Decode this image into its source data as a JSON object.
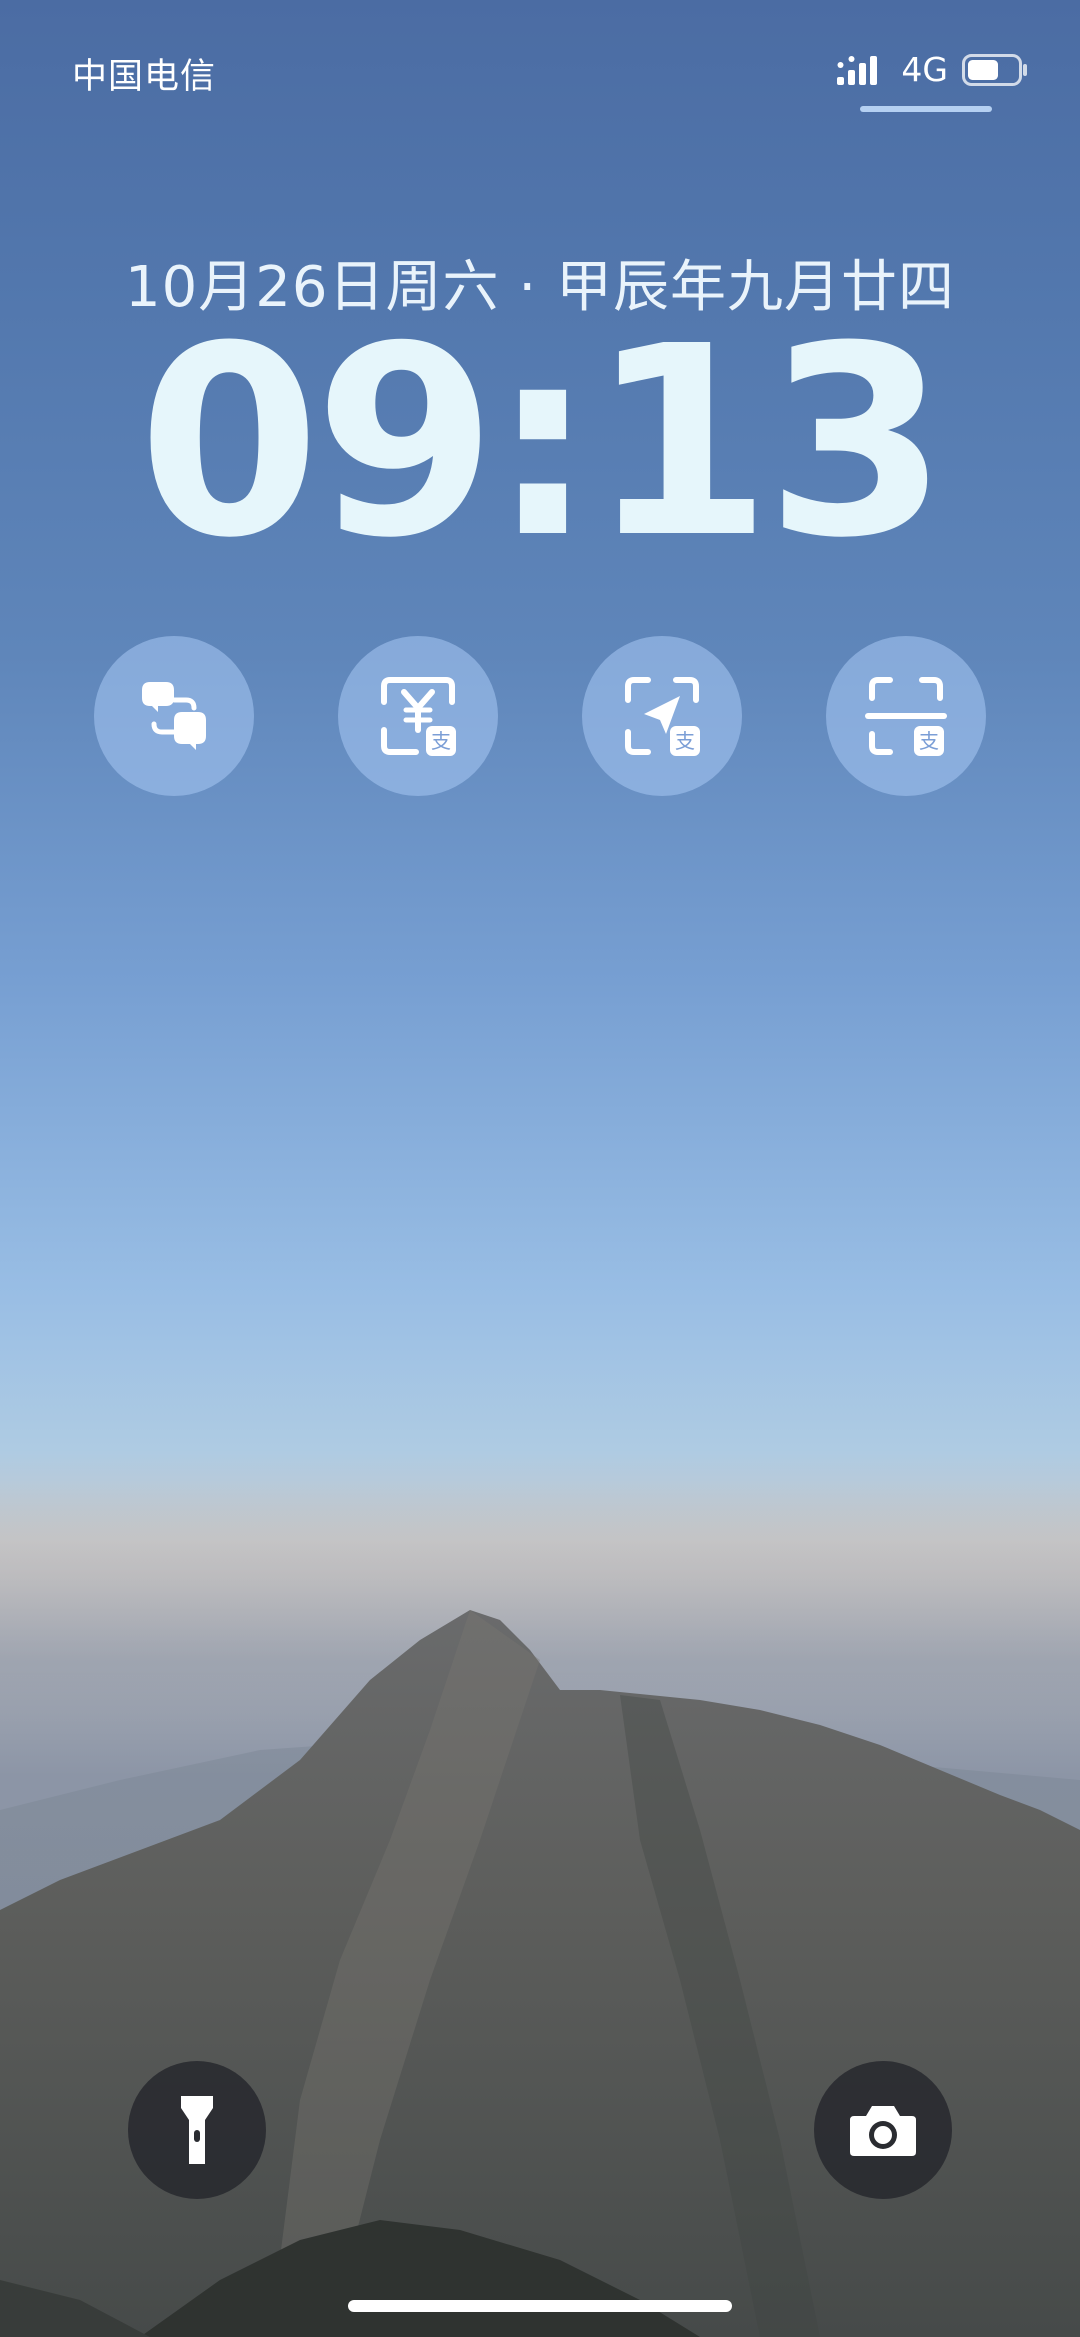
{
  "status_bar": {
    "carrier": "中国电信",
    "network": "4G",
    "signal_icon": "signal-bars-icon",
    "battery_icon": "battery-icon"
  },
  "lock_screen": {
    "date": "10月26日周六 · 甲辰年九月廿四",
    "time": "09:13"
  },
  "widgets": [
    {
      "name": "translate-widget",
      "icon": "translate-icon"
    },
    {
      "name": "alipay-pay-widget",
      "icon": "yuan-scan-icon",
      "badge": "支"
    },
    {
      "name": "alipay-travel-widget",
      "icon": "navigation-scan-icon",
      "badge": "支"
    },
    {
      "name": "alipay-scan-widget",
      "icon": "scan-icon",
      "badge": "支"
    }
  ],
  "bottom": {
    "flashlight_icon": "flashlight-icon",
    "camera_icon": "camera-icon"
  },
  "colors": {
    "sky_top": "#4b6ca3",
    "sky_horizon": "#98bde4",
    "time_text": "#e6f6fb",
    "widget_bg": "#a8c8f4"
  }
}
